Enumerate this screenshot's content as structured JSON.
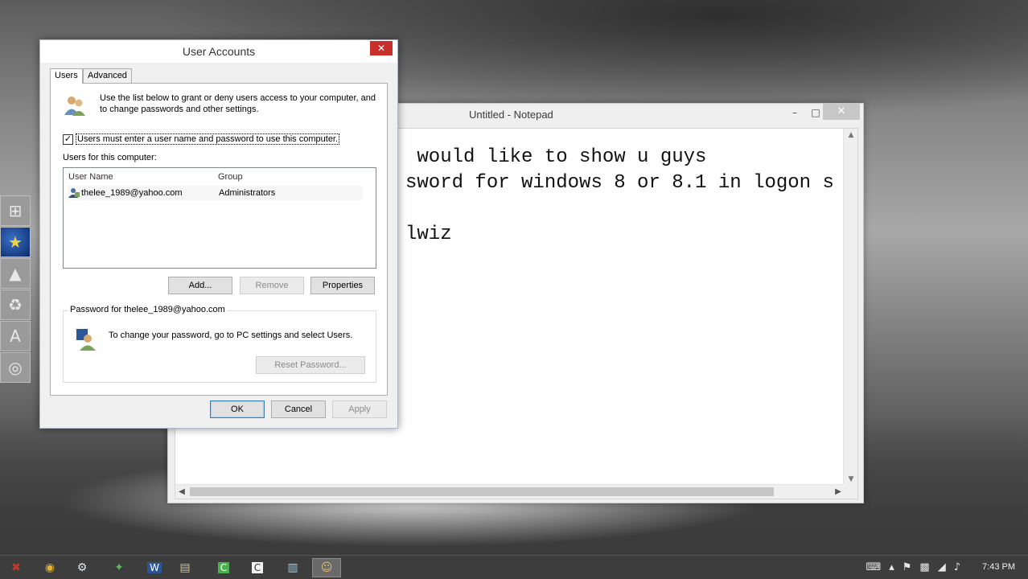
{
  "notepad": {
    "title": "Untitled - Notepad",
    "minimize": "–",
    "maximize": "□",
    "close": "✕",
    "text_lines": [
      " would like to show u guys",
      "sword for windows 8 or 8.1 in logon s",
      "",
      "lwiz"
    ]
  },
  "dialog": {
    "title": "User Accounts",
    "close": "✕",
    "tabs": [
      "Users",
      "Advanced"
    ],
    "info_text": "Use the list below to grant or deny users access to your computer, and to change passwords and other settings.",
    "checkbox_checked": true,
    "checkbox_mark": "✓",
    "checkbox_label": "Users must enter a user name and password to use this computer.",
    "users_label": "Users for this computer:",
    "columns": [
      "User Name",
      "Group"
    ],
    "users": [
      {
        "name": "thelee_1989@yahoo.com",
        "group": "Administrators"
      }
    ],
    "buttons": {
      "add": "Add...",
      "remove": "Remove",
      "properties": "Properties",
      "reset_password": "Reset Password...",
      "ok": "OK",
      "cancel": "Cancel",
      "apply": "Apply"
    },
    "password_group_title": "Password for thelee_1989@yahoo.com",
    "password_text": "To change your password, go to PC settings and select Users."
  },
  "launcher": {
    "icons": [
      {
        "name": "windows-icon",
        "glyph": "⊞"
      },
      {
        "name": "globe-icon",
        "glyph": "★"
      },
      {
        "name": "photos-icon",
        "glyph": "▲"
      },
      {
        "name": "recycle-bin-icon",
        "glyph": "♻"
      },
      {
        "name": "font-icon",
        "glyph": "A"
      },
      {
        "name": "disc-icon",
        "glyph": "◎"
      }
    ]
  },
  "taskbar": {
    "items": [
      {
        "name": "dota-icon",
        "glyph": "✖",
        "color": "#c0392b"
      },
      {
        "name": "chrome-icon",
        "glyph": "◉",
        "color": "#e8b22c"
      },
      {
        "name": "steam-icon",
        "glyph": "⚙",
        "color": "#dfe6ee"
      },
      {
        "name": "app-green-icon",
        "glyph": "✦",
        "color": "#5cb85c"
      },
      {
        "name": "word-icon",
        "glyph": "W",
        "color": "#2b5797"
      },
      {
        "name": "file-explorer-icon",
        "glyph": "▤",
        "color": "#e8c35a"
      },
      {
        "name": "camtasia-icon",
        "glyph": "C",
        "color": "#4caf50"
      },
      {
        "name": "ccleaner-icon",
        "glyph": "C",
        "color": "#f2f2f2"
      },
      {
        "name": "notepad-icon",
        "glyph": "▥",
        "color": "#9ecbe8"
      },
      {
        "name": "user-accounts-icon",
        "glyph": "☺",
        "color": "#e0c070"
      }
    ],
    "tray": [
      "⌨",
      "▴",
      "⚑",
      "▩",
      "◢",
      "♪"
    ],
    "clock": "7:43 PM"
  }
}
